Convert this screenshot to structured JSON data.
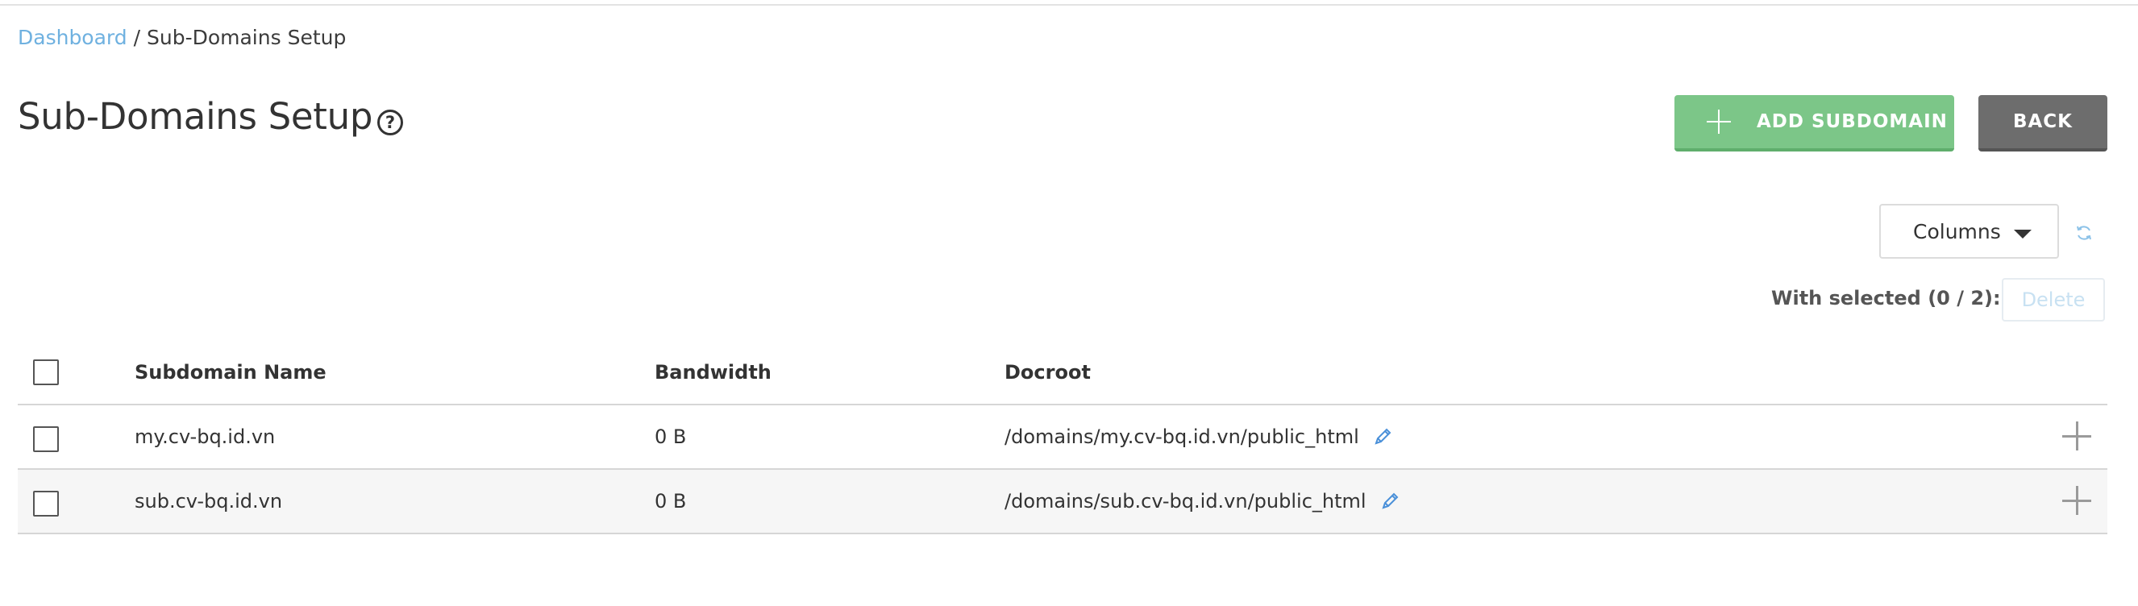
{
  "breadcrumb": {
    "link": "Dashboard",
    "separator": "/",
    "current": "Sub-Domains Setup"
  },
  "page": {
    "title": "Sub-Domains Setup",
    "help_glyph": "?"
  },
  "actions": {
    "add_label": "ADD SUBDOMAIN",
    "back_label": "BACK"
  },
  "toolbar": {
    "columns_label": "Columns",
    "with_selected": "With selected (0 / 2):",
    "delete_label": "Delete"
  },
  "table": {
    "headers": {
      "name": "Subdomain Name",
      "bandwidth": "Bandwidth",
      "docroot": "Docroot"
    },
    "rows": [
      {
        "name": "my.cv-bq.id.vn",
        "bandwidth": "0 B",
        "docroot": "/domains/my.cv-bq.id.vn/public_html"
      },
      {
        "name": "sub.cv-bq.id.vn",
        "bandwidth": "0 B",
        "docroot": "/domains/sub.cv-bq.id.vn/public_html"
      }
    ]
  },
  "icons": {
    "help": "question-circle-icon",
    "add": "plus-icon",
    "columns_caret": "caret-down-icon",
    "refresh": "refresh-icon",
    "edit": "pencil-icon",
    "row_expand": "plus-icon"
  },
  "colors": {
    "link": "#6fb1e0",
    "add_button": "#7cc688",
    "back_button": "#6d6d6d",
    "delete_disabled": "#c8e1f2",
    "edit_icon": "#4a90d9"
  }
}
